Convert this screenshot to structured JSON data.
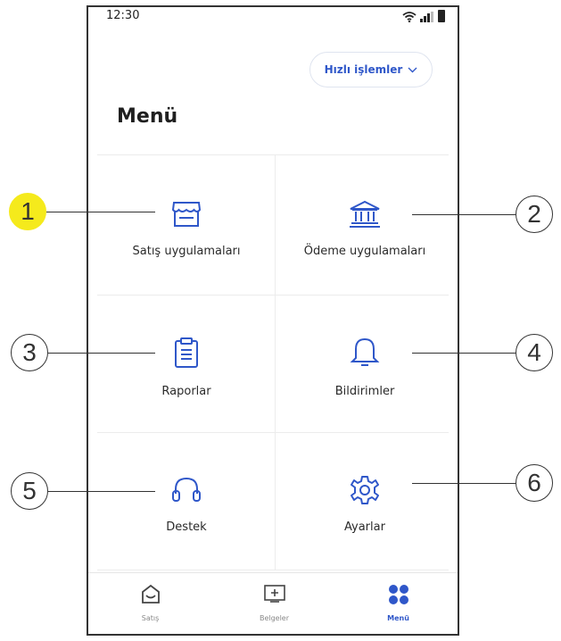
{
  "status_bar": {
    "time": "12:30"
  },
  "header": {
    "quick_actions_label": "Hızlı işlemler"
  },
  "page_title": "Menü",
  "tiles": [
    {
      "label": "Satış uygulamaları",
      "icon": "storefront-icon"
    },
    {
      "label": "Ödeme uygulamaları",
      "icon": "bank-icon"
    },
    {
      "label": "Raporlar",
      "icon": "clipboard-icon"
    },
    {
      "label": "Bildirimler",
      "icon": "bell-icon"
    },
    {
      "label": "Destek",
      "icon": "headset-icon"
    },
    {
      "label": "Ayarlar",
      "icon": "gear-icon"
    }
  ],
  "bottom_nav": [
    {
      "label": "Satış",
      "icon": "home-icon",
      "active": false
    },
    {
      "label": "Belgeler",
      "icon": "document-add-icon",
      "active": false
    },
    {
      "label": "Menü",
      "icon": "grid-icon",
      "active": true
    }
  ],
  "callouts": [
    "1",
    "2",
    "3",
    "4",
    "5",
    "6"
  ],
  "colors": {
    "accent": "#2f57c9",
    "callout_highlight": "#f5ea1c",
    "divider": "#ececec"
  }
}
